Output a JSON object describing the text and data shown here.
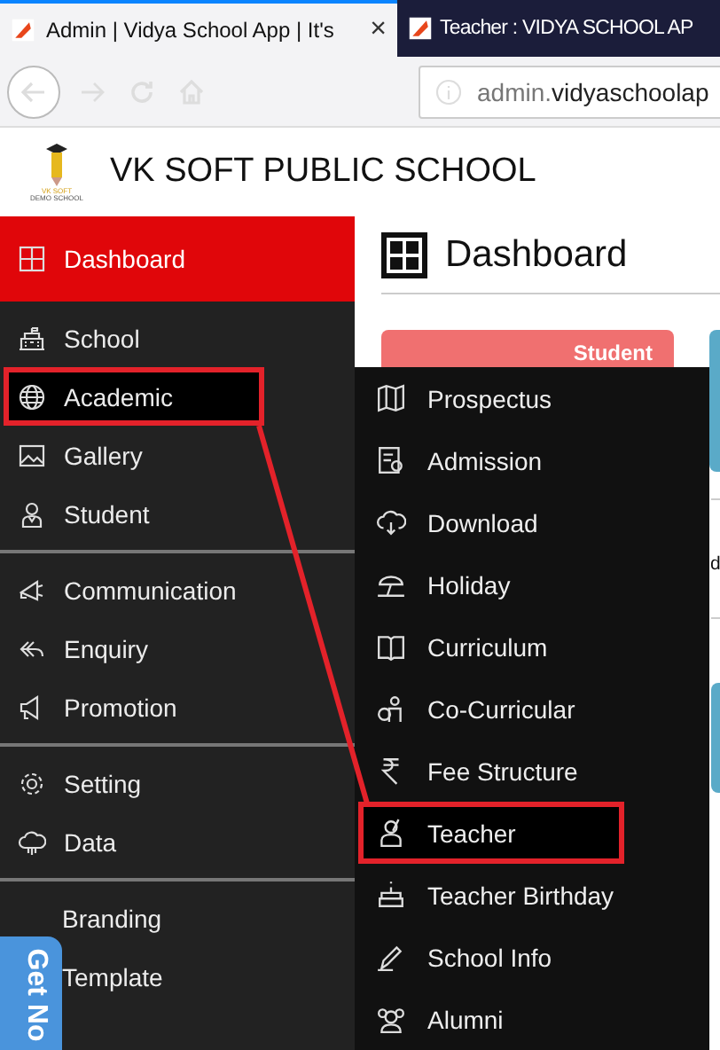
{
  "browser": {
    "tabs": [
      {
        "title": "Admin | Vidya School App | It's",
        "selected": true,
        "close": "×"
      },
      {
        "title": "Teacher : VIDYA SCHOOL AP",
        "selected": false
      }
    ],
    "address": {
      "host_prefix": "admin.",
      "host_rest": "vidyaschoolap"
    }
  },
  "header": {
    "logo_line1": "VK SOFT",
    "logo_line2": "DEMO SCHOOL",
    "school_name": "VK SOFT PUBLIC SCHOOL"
  },
  "sidebar": {
    "groups": [
      [
        {
          "label": "Dashboard",
          "selected": true,
          "expanded": false,
          "outlined": false
        }
      ],
      [
        {
          "label": "School",
          "selected": false,
          "expanded": false,
          "outlined": false
        },
        {
          "label": "Academic",
          "selected": false,
          "expanded": true,
          "outlined": true
        },
        {
          "label": "Gallery",
          "selected": false,
          "expanded": false,
          "outlined": false
        },
        {
          "label": "Student",
          "selected": false,
          "expanded": false,
          "outlined": false
        }
      ],
      [
        {
          "label": "Communication",
          "selected": false,
          "expanded": false,
          "outlined": false
        },
        {
          "label": "Enquiry",
          "selected": false,
          "expanded": false,
          "outlined": false
        },
        {
          "label": "Promotion",
          "selected": false,
          "expanded": false,
          "outlined": false
        }
      ],
      [
        {
          "label": "Setting",
          "selected": false,
          "expanded": false,
          "outlined": false
        },
        {
          "label": "Data",
          "selected": false,
          "expanded": false,
          "outlined": false
        }
      ],
      [
        {
          "label": "Branding",
          "selected": false,
          "expanded": false,
          "outlined": false
        },
        {
          "label": "Template",
          "selected": false,
          "expanded": false,
          "outlined": false
        }
      ]
    ]
  },
  "submenu": {
    "items": [
      {
        "label": "Prospectus",
        "selected": false,
        "outlined": false
      },
      {
        "label": "Admission",
        "selected": false,
        "outlined": false
      },
      {
        "label": "Download",
        "selected": false,
        "outlined": false
      },
      {
        "label": "Holiday",
        "selected": false,
        "outlined": false
      },
      {
        "label": "Curriculum",
        "selected": false,
        "outlined": false
      },
      {
        "label": "Co-Curricular",
        "selected": false,
        "outlined": false
      },
      {
        "label": "Fee Structure",
        "selected": false,
        "outlined": false
      },
      {
        "label": "Teacher",
        "selected": true,
        "outlined": true
      },
      {
        "label": "Teacher Birthday",
        "selected": false,
        "outlined": false
      },
      {
        "label": "School Info",
        "selected": false,
        "outlined": false
      },
      {
        "label": "Alumni",
        "selected": false,
        "outlined": false
      }
    ]
  },
  "content": {
    "title": "Dashboard",
    "card_label": "Student",
    "cut_text": "d"
  },
  "feedback_tab": {
    "label": "Get No"
  }
}
